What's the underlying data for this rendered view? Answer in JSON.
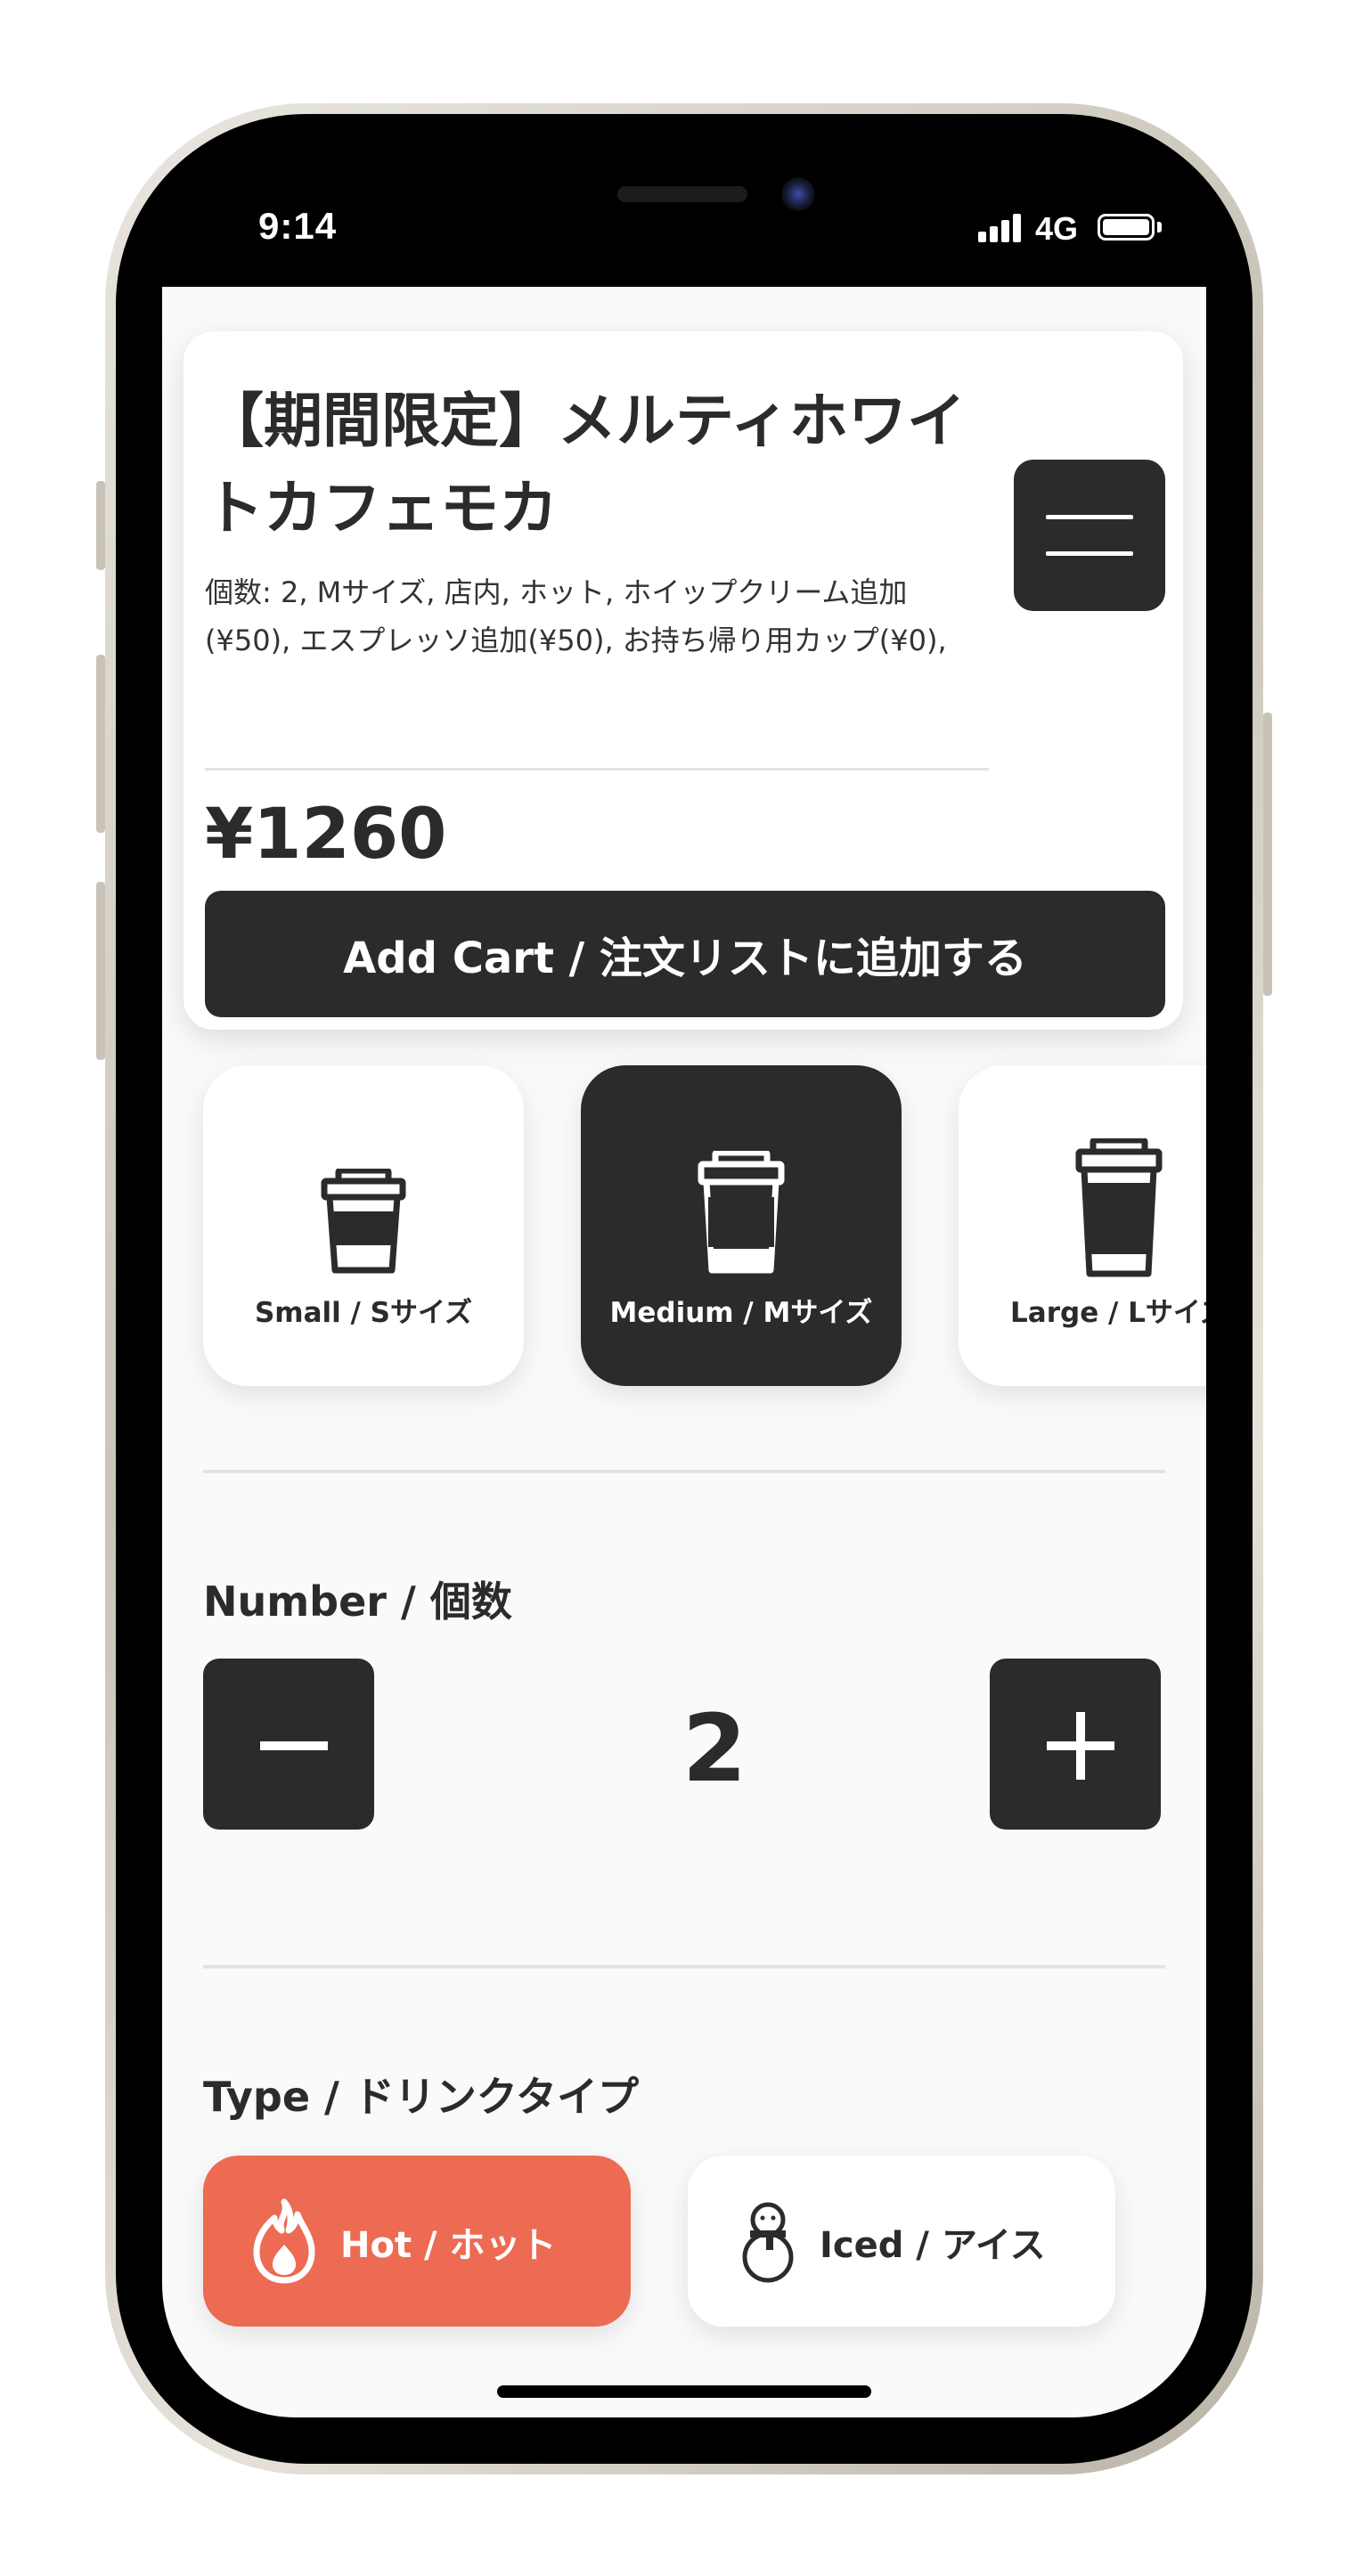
{
  "status_bar": {
    "time": "9:14",
    "network": "4G"
  },
  "product": {
    "title": "【期間限定】メルティホワイトカフェモカ",
    "options_summary": "個数: 2, Mサイズ, 店内, ホット, ホイップクリーム追加(¥50), エスプレッソ追加(¥50), お持ち帰り用カップ(¥0),",
    "price": "¥1260",
    "add_cart_label": "Add Cart / 注文リストに追加する"
  },
  "sizes": [
    {
      "label": "Small / Sサイズ",
      "selected": false
    },
    {
      "label": "Medium / Mサイズ",
      "selected": true
    },
    {
      "label": "Large / Lサイズ",
      "selected": false
    }
  ],
  "quantity": {
    "title": "Number / 個数",
    "value": "2"
  },
  "drink_type": {
    "title": "Type / ドリンクタイプ",
    "options": [
      {
        "label": "Hot / ホット",
        "icon": "flame-icon",
        "selected": true
      },
      {
        "label": "Iced / アイス",
        "icon": "snowman-icon",
        "selected": false
      }
    ]
  },
  "colors": {
    "dark": "#2b2b2b",
    "accent_hot": "#ec6b52",
    "background": "#fafafa"
  }
}
